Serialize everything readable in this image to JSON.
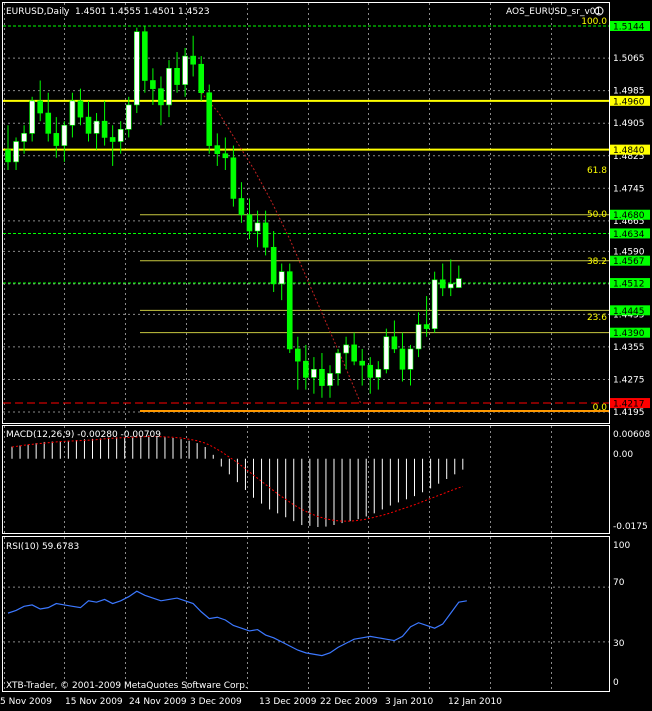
{
  "main": {
    "symbol_label": "EURUSD,Daily",
    "ohlc": "1.4501 1.4555 1.4501 1.4523",
    "indicator_label": "AOS_EURUSD_sr_v01",
    "price_scale": [
      "1.5065",
      "1.4985",
      "1.4905",
      "1.4825",
      "1.4745",
      "1.4665",
      "1.4590",
      "1.4510",
      "1.4435",
      "1.4355",
      "1.4275",
      "1.4195"
    ],
    "levels": [
      {
        "price": "1.5144",
        "type": "green"
      },
      {
        "price": "1.4960",
        "type": "yellow"
      },
      {
        "price": "1.4840",
        "type": "yellow"
      },
      {
        "price": "1.4680",
        "type": "yellow-thin"
      },
      {
        "price": "1.4634",
        "type": "green"
      },
      {
        "price": "1.4567",
        "type": "yellow-thin"
      },
      {
        "price": "1.4512",
        "type": "green"
      },
      {
        "price": "1.4445",
        "type": "yellow-thin"
      },
      {
        "price": "1.4390",
        "type": "yellow-thin"
      },
      {
        "price": "1.4217",
        "type": "red"
      }
    ],
    "fib_labels": [
      "100.0",
      "61.8",
      "50.0",
      "38.2",
      "23.6",
      "0.0"
    ]
  },
  "macd": {
    "label": "MACD(12,26,9) -0.00280 -0.00709",
    "scale": [
      "0.00608",
      "0.00",
      "-0.0175"
    ]
  },
  "rsi": {
    "label": "RSI(10) 59.6783",
    "scale": [
      "100",
      "70",
      "30",
      "0"
    ]
  },
  "footer": {
    "copyright": "XTB-Trader, © 2001-2009 MetaQuotes Software Corp.",
    "dates": [
      "5 Nov 2009",
      "15 Nov 2009",
      "24 Nov 2009",
      "3 Dec 2009",
      "13 Dec 2009",
      "22 Dec 2009",
      "3 Jan 2010",
      "12 Jan 2010"
    ]
  },
  "colors": {
    "background": "#000000",
    "bull": "#ffffff",
    "bear": "#00ff00",
    "support": "#ffff00",
    "price_tag_green": "#00ff00",
    "fib_line": "#c8c840",
    "rsi_line": "#3c78ff",
    "macd_signal": "#ff0000"
  },
  "chart_data": {
    "type": "candlestick",
    "candles": [
      [
        1.484,
        1.49,
        1.479,
        1.481
      ],
      [
        1.481,
        1.487,
        1.479,
        1.486
      ],
      [
        1.486,
        1.49,
        1.483,
        1.488
      ],
      [
        1.488,
        1.497,
        1.486,
        1.496
      ],
      [
        1.496,
        1.501,
        1.491,
        1.493
      ],
      [
        1.493,
        1.498,
        1.486,
        1.488
      ],
      [
        1.488,
        1.492,
        1.482,
        1.485
      ],
      [
        1.485,
        1.491,
        1.481,
        1.49
      ],
      [
        1.49,
        1.498,
        1.487,
        1.496
      ],
      [
        1.496,
        1.499,
        1.49,
        1.492
      ],
      [
        1.492,
        1.496,
        1.486,
        1.488
      ],
      [
        1.488,
        1.493,
        1.484,
        1.491
      ],
      [
        1.491,
        1.496,
        1.485,
        1.487
      ],
      [
        1.487,
        1.49,
        1.48,
        1.486
      ],
      [
        1.486,
        1.491,
        1.483,
        1.489
      ],
      [
        1.489,
        1.497,
        1.487,
        1.495
      ],
      [
        1.495,
        1.514,
        1.493,
        1.513
      ],
      [
        1.513,
        1.5144,
        1.498,
        1.501
      ],
      [
        1.501,
        1.504,
        1.495,
        1.499
      ],
      [
        1.499,
        1.502,
        1.49,
        1.495
      ],
      [
        1.495,
        1.506,
        1.492,
        1.504
      ],
      [
        1.504,
        1.508,
        1.498,
        1.5
      ],
      [
        1.5,
        1.509,
        1.497,
        1.507
      ],
      [
        1.507,
        1.512,
        1.502,
        1.505
      ],
      [
        1.505,
        1.507,
        1.496,
        1.498
      ],
      [
        1.498,
        1.5,
        1.483,
        1.485
      ],
      [
        1.485,
        1.488,
        1.48,
        1.483
      ],
      [
        1.483,
        1.487,
        1.479,
        1.482
      ],
      [
        1.482,
        1.485,
        1.47,
        1.472
      ],
      [
        1.472,
        1.476,
        1.466,
        1.468
      ],
      [
        1.468,
        1.472,
        1.462,
        1.464
      ],
      [
        1.464,
        1.469,
        1.46,
        1.466
      ],
      [
        1.466,
        1.469,
        1.458,
        1.46
      ],
      [
        1.46,
        1.464,
        1.449,
        1.451
      ],
      [
        1.451,
        1.456,
        1.447,
        1.454
      ],
      [
        1.454,
        1.456,
        1.434,
        1.435
      ],
      [
        1.435,
        1.438,
        1.425,
        1.432
      ],
      [
        1.432,
        1.436,
        1.425,
        1.428
      ],
      [
        1.428,
        1.433,
        1.424,
        1.43
      ],
      [
        1.43,
        1.434,
        1.423,
        1.426
      ],
      [
        1.426,
        1.431,
        1.423,
        1.429
      ],
      [
        1.429,
        1.435,
        1.426,
        1.434
      ],
      [
        1.434,
        1.438,
        1.43,
        1.436
      ],
      [
        1.436,
        1.439,
        1.431,
        1.432
      ],
      [
        1.432,
        1.435,
        1.426,
        1.431
      ],
      [
        1.431,
        1.433,
        1.424,
        1.428
      ],
      [
        1.428,
        1.432,
        1.425,
        1.43
      ],
      [
        1.43,
        1.44,
        1.429,
        1.438
      ],
      [
        1.438,
        1.442,
        1.434,
        1.435
      ],
      [
        1.435,
        1.439,
        1.427,
        1.43
      ],
      [
        1.43,
        1.436,
        1.426,
        1.435
      ],
      [
        1.435,
        1.444,
        1.433,
        1.441
      ],
      [
        1.441,
        1.448,
        1.438,
        1.44
      ],
      [
        1.44,
        1.454,
        1.439,
        1.452
      ],
      [
        1.452,
        1.456,
        1.448,
        1.45
      ],
      [
        1.45,
        1.457,
        1.448,
        1.451
      ],
      [
        1.4501,
        1.4555,
        1.4501,
        1.4523
      ]
    ],
    "ma_line": [
      [
        20,
        1.498
      ],
      [
        22,
        1.493
      ],
      [
        24,
        1.486
      ],
      [
        26,
        1.479
      ],
      [
        28,
        1.471
      ],
      [
        30,
        1.462
      ],
      [
        32,
        1.452
      ],
      [
        34,
        1.442
      ],
      [
        36,
        1.432
      ],
      [
        38,
        1.4217
      ]
    ],
    "macd_hist": [
      0.0031,
      0.0034,
      0.0036,
      0.004,
      0.0043,
      0.0044,
      0.0045,
      0.0046,
      0.0048,
      0.005,
      0.0051,
      0.0052,
      0.0054,
      0.0055,
      0.0056,
      0.0057,
      0.0059,
      0.006,
      0.0058,
      0.0056,
      0.0053,
      0.005,
      0.0046,
      0.004,
      0.003,
      0.001,
      -0.002,
      -0.004,
      -0.006,
      -0.008,
      -0.01,
      -0.0115,
      -0.013,
      -0.014,
      -0.015,
      -0.016,
      -0.017,
      -0.0172,
      -0.0175,
      -0.0174,
      -0.017,
      -0.0165,
      -0.016,
      -0.0155,
      -0.0148,
      -0.014,
      -0.013,
      -0.012,
      -0.0112,
      -0.0104,
      -0.0096,
      -0.0086,
      -0.0076,
      -0.0064,
      -0.0052,
      -0.004,
      -0.0028
    ],
    "macd_signal": [
      0.003,
      0.0033,
      0.0036,
      0.0038,
      0.004,
      0.0042,
      0.0044,
      0.0045,
      0.0046,
      0.0047,
      0.0048,
      0.005,
      0.0052,
      0.0053,
      0.0054,
      0.0055,
      0.0056,
      0.0057,
      0.0057,
      0.0056,
      0.0055,
      0.0053,
      0.005,
      0.0046,
      0.004,
      0.003,
      0.0018,
      0.0004,
      -0.001,
      -0.0026,
      -0.0042,
      -0.0058,
      -0.0074,
      -0.009,
      -0.0104,
      -0.0118,
      -0.013,
      -0.014,
      -0.0148,
      -0.0154,
      -0.0158,
      -0.016,
      -0.016,
      -0.0158,
      -0.0155,
      -0.015,
      -0.0145,
      -0.0139,
      -0.0132,
      -0.0125,
      -0.0118,
      -0.011,
      -0.0102,
      -0.0094,
      -0.0086,
      -0.0078,
      -0.0071
    ],
    "rsi": [
      51,
      53,
      56,
      57,
      54,
      55,
      58,
      57,
      56,
      55,
      60,
      59,
      61,
      58,
      60,
      63,
      67,
      64,
      62,
      60,
      61,
      62,
      60,
      58,
      52,
      47,
      48,
      46,
      42,
      40,
      38,
      39,
      35,
      33,
      30,
      27,
      24,
      22,
      21,
      20,
      22,
      26,
      29,
      32,
      33,
      34,
      33,
      32,
      31,
      34,
      41,
      44,
      42,
      40,
      43,
      51,
      59,
      60
    ],
    "rsi_levels": [
      70,
      30
    ]
  }
}
